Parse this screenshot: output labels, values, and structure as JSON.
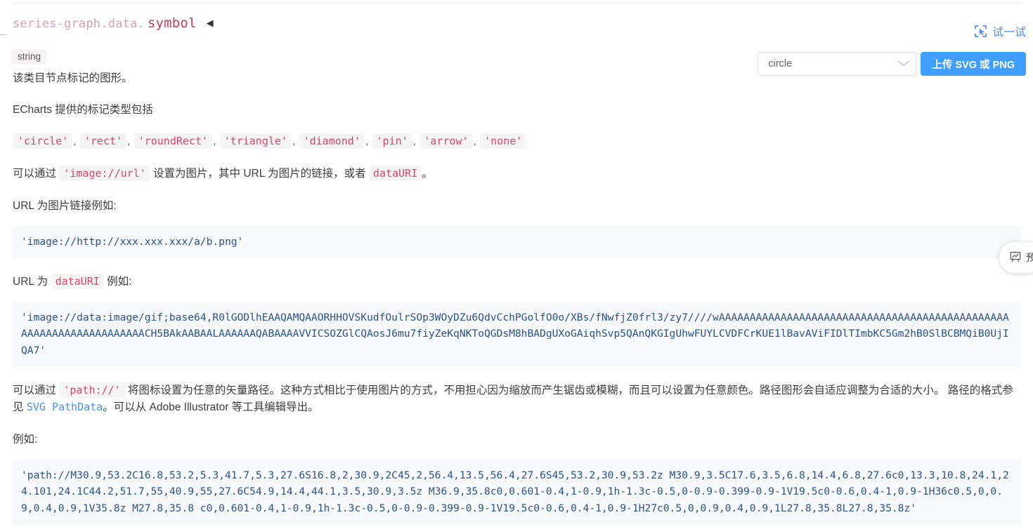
{
  "header": {
    "title_prefix": "series-graph.data.",
    "title_key": "symbol",
    "collapse_arrow": "◀",
    "type_badge": "string",
    "tryit_label": "试一试",
    "tryit_icon": "try-it-cursor-frame-icon"
  },
  "controls": {
    "select_value": "circle",
    "select_chevron": "∨",
    "upload_label": "上传 SVG 或 PNG"
  },
  "content": {
    "p1": "该类目节点标记的图形。",
    "p2": "ECharts 提供的标记类型包括",
    "symbols": [
      "'circle'",
      "'rect'",
      "'roundRect'",
      "'triangle'",
      "'diamond'",
      "'pin'",
      "'arrow'",
      "'none'"
    ],
    "symbol_separator": ",",
    "p3_a": "可以通过",
    "p3_code1": "'image://url'",
    "p3_b": "设置为图片，其中 URL 为图片的链接，或者",
    "p3_code2": "dataURI",
    "p3_c": "。",
    "p4": "URL 为图片链接例如:",
    "code1": "'image://http://xxx.xxx.xxx/a/b.png'",
    "p5_a": "URL 为",
    "p5_code": "dataURI",
    "p5_b": "例如:",
    "code2": "'image://data:image/gif;base64,R0lGODlhEAAQAMQAAORHHOVSKudfOulrSOp3WOyDZu6QdvCchPGolfO0o/XBs/fNwfjZ0frl3/zy7////wAAAAAAAAAAAAAAAAAAAAAAAAAAAAAAAAAAAAAAAAAAAAAAAAAAAAAAAAAAAAAAAAAAACH5BAkAABAALAAAAAAQABAAAAVVICSOZGlCQAosJ6mu7fiyZeKqNKToQGDsM8hBADgUXoGAiqhSvp5QAnQKGIgUhwFUYLCVDFCrKUE1lBavAViFIDlTImbKC5Gm2hB0SlBCBMQiB0UjIQA7'",
    "p6_a": "可以通过",
    "p6_code": "'path://'",
    "p6_b": "将图标设置为任意的矢量路径。这种方式相比于使用图片的方式，不用担心因为缩放而产生锯齿或模糊，而且可以设置为任意颜色。路径图形会自适应调整为合适的大小。",
    "p7_a": "路径的格式参见",
    "p7_link": "SVG PathData",
    "p7_b": "。可以从 Adobe Illustrator 等工具编辑导出。",
    "p8": "例如:",
    "code3": "'path://M30.9,53.2C16.8,53.2,5.3,41.7,5.3,27.6S16.8,2,30.9,2C45,2,56.4,13.5,56.4,27.6S45,53.2,30.9,53.2z M30.9,3.5C17.6,3.5,6.8,14.4,6.8,27.6c0,13.3,10.8,24.1,24.101,24.1C44.2,51.7,55,40.9,55,27.6C54.9,14.4,44.1,3.5,30.9,3.5z M36.9,35.8c0,0.601-0.4,1-0.9,1h-1.3c-0.5,0-0.9-0.399-0.9-1V19.5c0-0.6,0.4-1,0.9-1H36c0.5,0,0.9,0.4,0.9,1V35.8z M27.8,35.8 c0,0.601-0.4,1-0.9,1h-1.3c-0.5,0-0.9-0.399-0.9-1V19.5c0-0.6,0.4-1,0.9-1H27c0.5,0,0.9,0.4,0.9,1L27.8,35.8L27.8,35.8z'"
  },
  "side_widget": {
    "label": "预",
    "icon": "presentation-chart-icon"
  },
  "colors": {
    "accent_blue": "#409eff",
    "link_blue": "#4a8df8",
    "code_pink": "#e1436a",
    "title_pink": "#c0405f",
    "code_bg": "#f6f8fa",
    "code_text": "#2b5288"
  }
}
